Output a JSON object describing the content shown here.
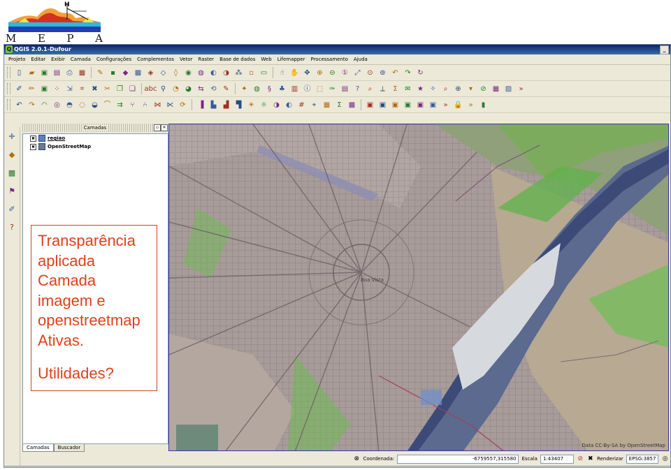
{
  "logo": {
    "letters": [
      "M",
      "E",
      "P",
      "A"
    ],
    "h_label": "H"
  },
  "window": {
    "title": "QGIS 2.0.1-Dufour",
    "app_icon": "Q"
  },
  "menu": [
    "Projeto",
    "Editar",
    "Exibir",
    "Camada",
    "Configurações",
    "Complementos",
    "Vetor",
    "Raster",
    "Base de dados",
    "Web",
    "Lifemapper",
    "Processamento",
    "Ajuda"
  ],
  "toolbar1_icons": [
    "new-icon",
    "open-icon",
    "save-icon",
    "save-as-icon",
    "print-icon",
    "layout-icon",
    "sep",
    "digitize-icon",
    "node-icon",
    "add-vector-icon",
    "add-raster-icon",
    "add-postgis-icon",
    "add-spatialite-icon",
    "add-mssql-icon",
    "add-oracle-icon",
    "add-wms-icon",
    "add-wfs-icon",
    "add-wcs-icon",
    "add-delimited-icon",
    "new-shapefile-icon",
    "new-spatialite-icon",
    "sep",
    "touch-icon",
    "pan-icon",
    "pan-to-selection-icon",
    "zoom-in-icon",
    "zoom-out-icon",
    "zoom-native-icon",
    "zoom-full-icon",
    "zoom-layer-icon",
    "zoom-selection-icon",
    "zoom-last-icon",
    "zoom-next-icon",
    "refresh-icon"
  ],
  "toolbar2_icons": [
    "edit-icon",
    "pencil-icon",
    "save-edits-icon",
    "add-feature-icon",
    "move-feature-icon",
    "node-tool-icon",
    "delete-icon",
    "cut-icon",
    "copy-icon",
    "paste-icon",
    "sep",
    "label-icon",
    "pin-icon",
    "show-hide-icon",
    "preview-icon",
    "move-label-icon",
    "rotate-label-icon",
    "change-label-icon",
    "sep",
    "plugin-icon",
    "globe-icon",
    "python-icon",
    "grass-icon",
    "chart-icon",
    "identify-icon",
    "select-icon",
    "brush-icon",
    "table-icon",
    "help-icon",
    "search-icon",
    "measure-icon",
    "stats-icon",
    "annotation-icon",
    "bookmark-icon",
    "tips-icon",
    "zoom-tool-icon",
    "magnify-icon",
    "select-dropdown-icon",
    "deselect-icon",
    "calculator-icon",
    "tiles-icon",
    "more-icon"
  ],
  "toolbar3_icons": [
    "undo-icon",
    "redo-icon",
    "simplify-icon",
    "add-ring-icon",
    "add-part-icon",
    "delete-ring-icon",
    "delete-part-icon",
    "reshape-icon",
    "offset-icon",
    "split-icon",
    "split-parts-icon",
    "merge-icon",
    "merge-attr-icon",
    "rotate-point-icon",
    "sep",
    "raster-calc-icon",
    "histogram-icon",
    "stretch-icon",
    "stretch-cumulative-icon",
    "increase-brightness-icon",
    "decrease-brightness-icon",
    "increase-contrast-icon",
    "decrease-contrast-icon",
    "grid-icon",
    "gps-icon",
    "georef-icon",
    "sum-icon",
    "map-icon",
    "sep",
    "vertex-icon",
    "vertex2-icon",
    "vertex3-icon",
    "vertex4-icon",
    "vertex5-icon",
    "vertex6-icon",
    "more-icon",
    "lock-icon",
    "more-icon",
    "extra-icon"
  ],
  "left_tools": [
    "digitize-point-icon",
    "add-vector-icon",
    "raster-icon",
    "toggle-icon",
    "edit-icon",
    "help-icon"
  ],
  "layers_panel": {
    "title": "Camadas",
    "layers": [
      {
        "name": "regiao",
        "checked": "✖",
        "selected": true
      },
      {
        "name": "OpenStreetMap",
        "checked": "✖",
        "selected": false
      }
    ],
    "tabs": [
      "Camadas",
      "Buscador"
    ]
  },
  "annotation": {
    "lines": [
      "Transparência",
      "aplicada",
      "Camada",
      "imagem e",
      "openstreetmap",
      "Ativas."
    ],
    "question": "Utilidades?"
  },
  "map": {
    "city_label": "Boa Vista",
    "attribution": "Data CC-By-SA by OpenStreetMap"
  },
  "statusbar": {
    "coord_label": "Coordenada:",
    "coord_value": "-6759557,315580",
    "scale_label": "Escala",
    "scale_value": "1:43407",
    "render_label": "Renderizar",
    "crs": "EPSG:3857"
  }
}
